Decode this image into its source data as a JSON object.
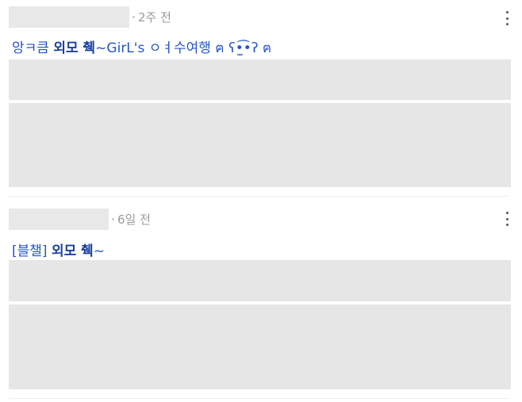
{
  "posts": [
    {
      "time": "2주 전",
      "title_prefix": "앙ㅋ큼 ",
      "title_bold": "외모 췍",
      "title_suffix": "~GirL's ㅇㅕ수여행 ฅ ʕ•̫͡•ʔ ฅ"
    },
    {
      "time": "6일 전",
      "title_prefix": "[블챌] ",
      "title_bold": "외모 췍",
      "title_suffix": "~"
    }
  ],
  "icons": {
    "more": "more-vertical-icon"
  }
}
